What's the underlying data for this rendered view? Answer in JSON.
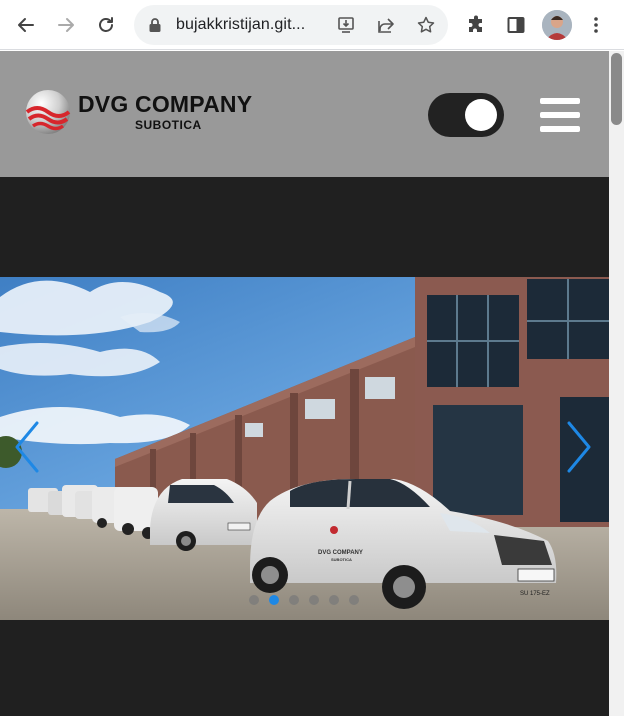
{
  "browser": {
    "url": "bujakkristijan.git...",
    "icons": [
      "back-icon",
      "forward-icon",
      "reload-icon",
      "lock-icon",
      "install-icon",
      "share-icon",
      "star-icon",
      "extensions-icon",
      "side-panel-icon",
      "profile-avatar",
      "more-icon"
    ]
  },
  "site": {
    "logo_name": "DVG COMPANY",
    "logo_sub": "SUBOTICA",
    "header_bg": "#999999",
    "page_bg": "#202020",
    "accent": "#1e88e5"
  },
  "slide": {
    "van_brand": "DVG COMPANY",
    "van_sub": "SUBOTICA",
    "plate": "SU 175-EZ"
  },
  "carousel": {
    "slide_count": 6,
    "active_index": 1
  }
}
